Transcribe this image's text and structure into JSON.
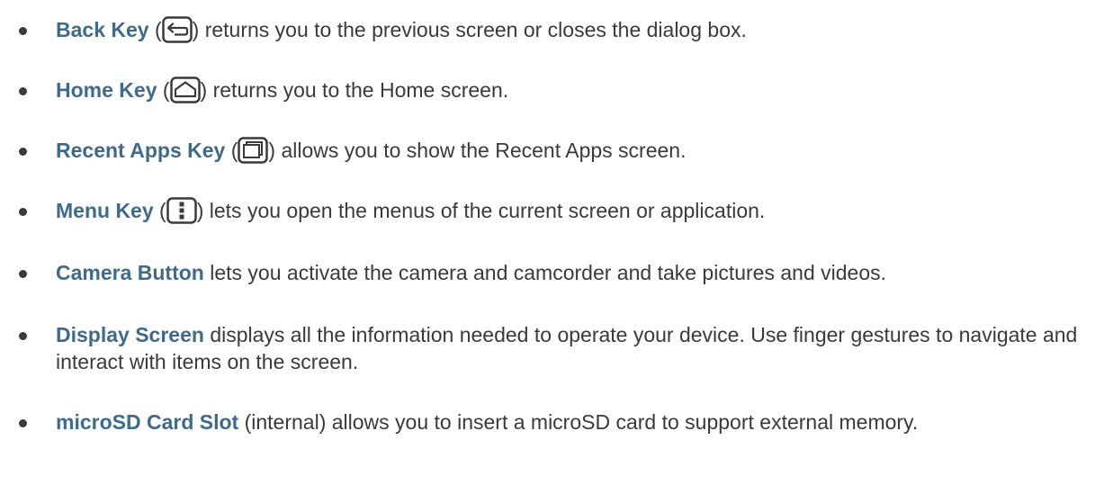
{
  "items": [
    {
      "term": "Back Key",
      "icon": "back-key-icon",
      "desc": "returns you to the previous screen or closes the dialog box."
    },
    {
      "term": "Home Key",
      "icon": "home-key-icon",
      "desc": "returns you to the Home screen."
    },
    {
      "term": "Recent Apps Key",
      "icon": "recent-apps-key-icon",
      "desc": "allows you to show the Recent Apps screen."
    },
    {
      "term": "Menu Key",
      "icon": "menu-key-icon",
      "desc": "lets you open the menus of the current screen or application."
    },
    {
      "term": "Camera Button",
      "desc": "lets you activate the camera and camcorder and take pictures and videos."
    },
    {
      "term": "Display Screen",
      "desc": "displays all the information needed to operate your device. Use finger gestures to navigate and interact with items on the screen."
    },
    {
      "term": "microSD Card Slot",
      "desc": "(internal) allows you to insert a microSD card to support external memory."
    }
  ],
  "colors": {
    "term": "#3f6a8a",
    "body_text": "#3a3a3a"
  }
}
